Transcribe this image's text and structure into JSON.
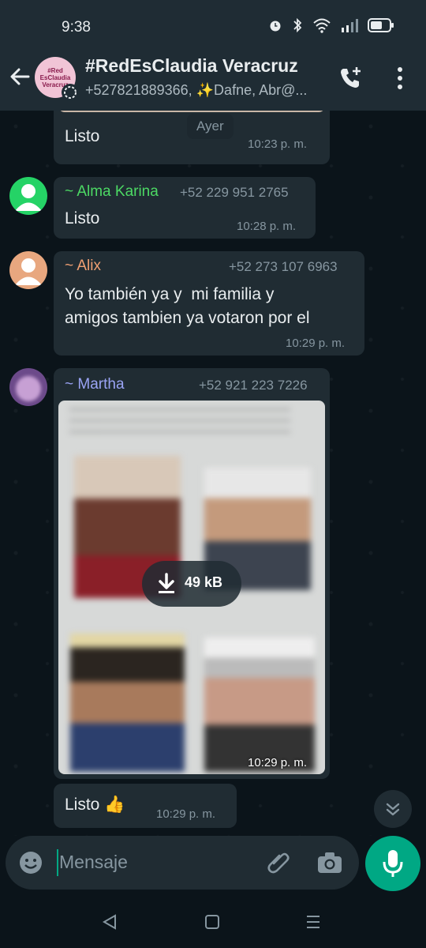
{
  "status_bar": {
    "time": "9:38"
  },
  "header": {
    "title": "#RedEsClaudia Veracruz",
    "subtitle": "+527821889366, ✨Dafne, Abr@...",
    "avatar_text": "#Red EsClaudia Veracruz"
  },
  "chat": {
    "date_chip": "Ayer",
    "messages": [
      {
        "text": "Listo",
        "time": "10:23 p. m."
      },
      {
        "sender": "~ Alma Karina",
        "phone": "+52 229 951 2765",
        "text": "Listo",
        "time": "10:28 p. m.",
        "sender_color": "#53bdeb"
      },
      {
        "sender": "~ Alix",
        "phone": "+52 273 107 6963",
        "text_line1": "Yo también ya y  mi familia y",
        "text_line2": "amigos tambien ya votaron por el",
        "time": "10:29 p. m."
      },
      {
        "sender": "~ Martha",
        "phone": "+52 921 223 7226",
        "image_size": "49 kB",
        "time": "10:29 p. m."
      },
      {
        "text": "Listo 👍",
        "time": "10:29 p. m."
      }
    ]
  },
  "input": {
    "placeholder": "Mensaje"
  },
  "colors": {
    "accent": "#00a884",
    "bubble": "#202c33",
    "header": "#1f2c34"
  }
}
